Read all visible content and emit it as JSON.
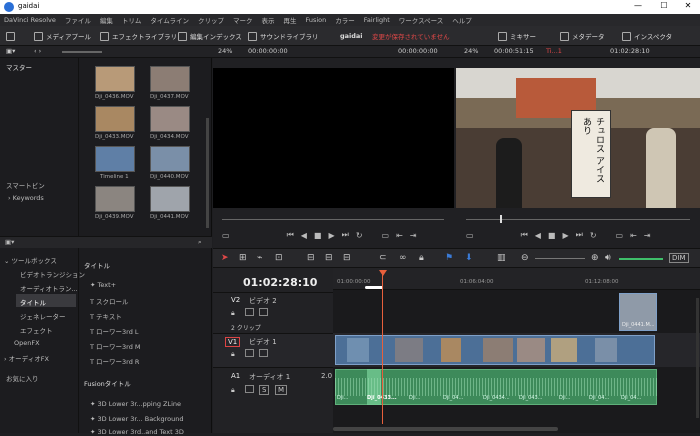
{
  "window": {
    "title": "gaidai",
    "min": "—",
    "max": "☐",
    "close": "✕"
  },
  "menu": [
    "DaVinci Resolve",
    "ファイル",
    "編集",
    "トリム",
    "タイムライン",
    "クリップ",
    "マーク",
    "表示",
    "再生",
    "Fusion",
    "カラー",
    "Fairlight",
    "ワークスペース",
    "ヘルプ"
  ],
  "toolbar": {
    "media_pool": "メディアプール",
    "effects_library": "エフェクトライブラリ",
    "edit_index": "編集インデックス",
    "sound_library": "サウンドライブラリ",
    "project_name": "gaidai",
    "unsaved": "変更が保存されていません",
    "mixer": "ミキサー",
    "metadata": "メタデータ",
    "inspector": "インスペクタ"
  },
  "subbar": {
    "zoom_left": "24%",
    "tc_left": "00:00:00:00",
    "tc_left2": "00:00:00:00",
    "zoom_right": "24%",
    "tc_right": "00:00:51:15",
    "timeline_name": "Ti...1",
    "tc_right2": "01:02:28:10"
  },
  "mediapool": {
    "master": "マスター",
    "smart_bins": "スマートビン",
    "keywords": "Keywords",
    "clips": [
      {
        "name": "Dji_0436.MOV"
      },
      {
        "name": "Dji_0437.MOV"
      },
      {
        "name": "Dji_0433.MOV"
      },
      {
        "name": "Dji_0434.MOV"
      },
      {
        "name": "Timeline 1"
      },
      {
        "name": "Dji_0440.MOV"
      },
      {
        "name": "Dji_0439.MOV"
      },
      {
        "name": "Dji_0441.MOV"
      }
    ]
  },
  "effects": {
    "toolbox": "ツールボックス",
    "video_transitions": "ビデオトランジション",
    "audio_transitions": "オーディオトラン...",
    "titles": "タイトル",
    "generators": "ジェネレーター",
    "effects": "エフェクト",
    "openfx": "OpenFX",
    "audiofx": "オーディオFX",
    "favorites": "お気に入り",
    "titles_header": "タイトル",
    "title_items": [
      "Text+",
      "スクロール",
      "テキスト",
      "ローワー3rd L",
      "ローワー3rd M",
      "ローワー3rd R"
    ],
    "fusion_titles_header": "Fusionタイトル",
    "fusion_items": [
      "3D Lower 3r...pping ZLine",
      "3D Lower 3r... Background",
      "3D Lower 3rd..and Text 3D"
    ]
  },
  "timeline": {
    "timecode": "01:02:28:10",
    "ruler": [
      "01:00:00:00",
      "01:06:04:00",
      "01:12:08:00"
    ],
    "v2": {
      "id": "V2",
      "name": "ビデオ 2",
      "count": "2 クリップ"
    },
    "v1": {
      "id": "V1",
      "name": "ビデオ 1"
    },
    "a1": {
      "id": "A1",
      "name": "オーディオ 1",
      "level": "2.0",
      "s": "S",
      "m": "M"
    },
    "v2_clip": "Dji_0441.M...",
    "audio_labels": [
      "Dji...",
      "Dji_0433...",
      "Dji...",
      "Dji_04...",
      "Dji_0434...",
      "Dji_043...",
      "Dji...",
      "Dji_04...",
      "Dji_04..."
    ]
  },
  "preview_sign": {
    "line1": "チュロス",
    "line2": "アイスあり"
  }
}
